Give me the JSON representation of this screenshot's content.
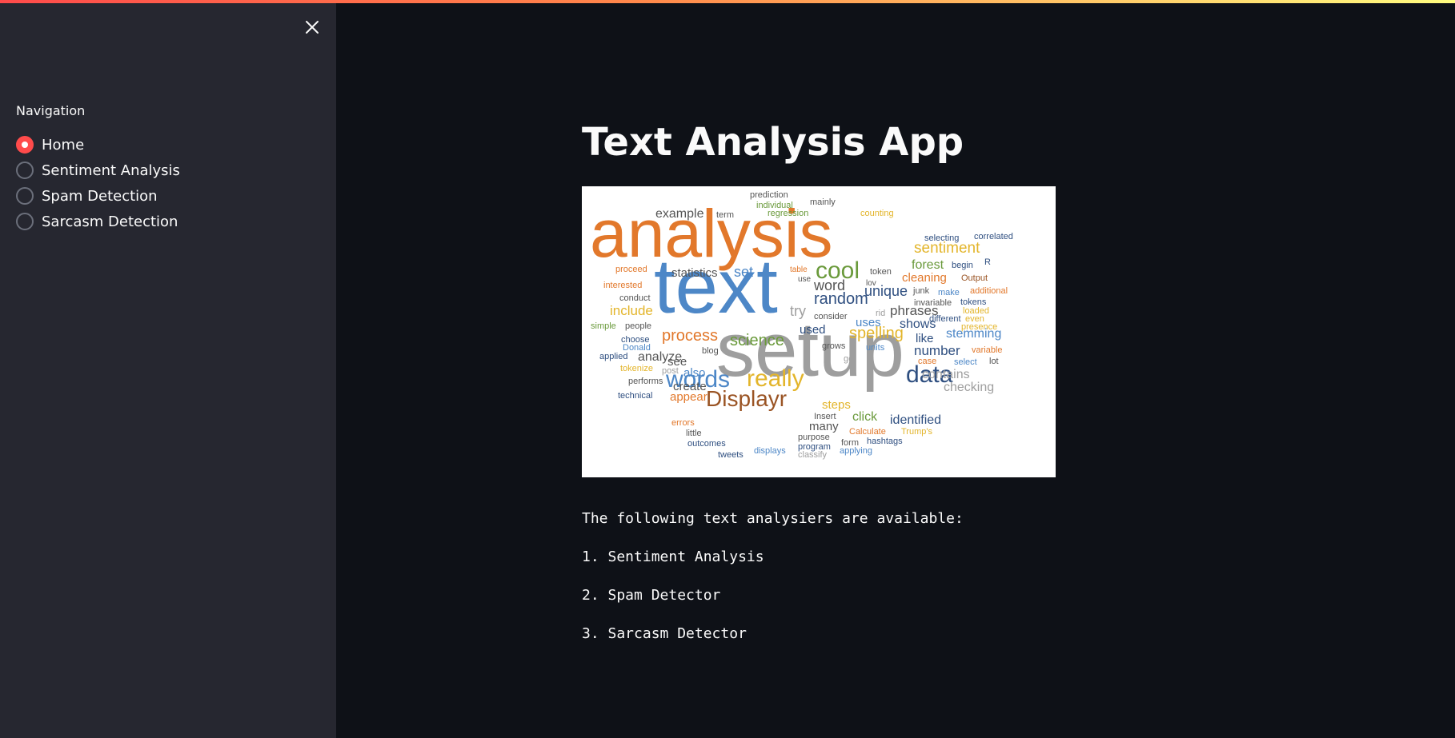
{
  "sidebar": {
    "close_icon": "close-icon",
    "nav_label": "Navigation",
    "options": [
      {
        "label": "Home",
        "selected": true
      },
      {
        "label": "Sentiment Analysis",
        "selected": false
      },
      {
        "label": "Spam Detection",
        "selected": false
      },
      {
        "label": "Sarcasm Detection",
        "selected": false
      }
    ]
  },
  "main": {
    "title": "Text Analysis App",
    "intro": "The following text analysiers are available:",
    "items": [
      "1. Sentiment Analysis",
      "2. Spam Detector",
      "3. Sarcasm Detector"
    ]
  },
  "wordcloud": {
    "words": [
      "analysis",
      "text",
      "setup",
      "data",
      "words",
      "really",
      "Displayr",
      "cool",
      "sentiment",
      "process",
      "science",
      "spelling",
      "random",
      "unique",
      "statistics",
      "set",
      "word",
      "example",
      "phrases",
      "number",
      "forest",
      "stemming",
      "shows",
      "uses",
      "cleaning",
      "include",
      "analyze",
      "contains",
      "checking",
      "identified",
      "create",
      "appear",
      "click",
      "steps",
      "many",
      "like",
      "also",
      "see",
      "used",
      "try",
      "prediction",
      "individual",
      "regression",
      "mainly",
      "counting",
      "term",
      "selecting",
      "correlated",
      "begin",
      "Output",
      "token",
      "table",
      "use",
      "lov",
      "junk",
      "make",
      "additional",
      "tokens",
      "invariable",
      "loaded",
      "different",
      "even",
      "presence",
      "proceed",
      "interested",
      "conduct",
      "simple",
      "people",
      "choose",
      "Donald",
      "blog",
      "grows",
      "units",
      "variable",
      "case",
      "select",
      "lot",
      "applied",
      "tokenize",
      "post",
      "get",
      "performs",
      "technical",
      "errors",
      "little",
      "outcomes",
      "tweets",
      "displays",
      "classify",
      "applying",
      "purpose",
      "program",
      "form",
      "hashtags",
      "Calculate",
      "Trump's",
      "Insert",
      "consider",
      "rid",
      "R"
    ],
    "colors": {
      "orange": "#e2782b",
      "blue": "#4d87c7",
      "gray": "#9e9e9e",
      "green": "#6a9a3b",
      "yellow": "#e3b52b",
      "navy": "#2f4f80",
      "brown": "#9a5424",
      "darkgray": "#555555"
    }
  },
  "colors": {
    "accent": "#ff4b4b",
    "sidebar_bg": "#262730",
    "main_bg": "#0e1117",
    "text": "#fafafa"
  }
}
